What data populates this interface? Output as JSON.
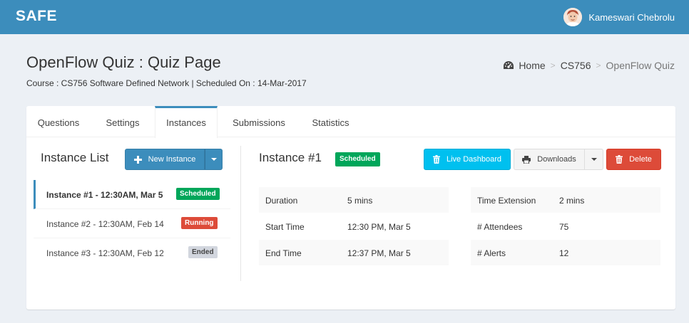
{
  "topbar": {
    "brand": "SAFE",
    "user_name": "Kameswari Chebrolu"
  },
  "page": {
    "title": "OpenFlow Quiz : Quiz Page",
    "subtitle": "Course : CS756 Software Defined Network | Scheduled On : 14-Mar-2017"
  },
  "breadcrumb": {
    "home": "Home",
    "course": "CS756",
    "current": "OpenFlow Quiz",
    "separator": ">"
  },
  "tabs": [
    {
      "label": "Questions"
    },
    {
      "label": "Settings"
    },
    {
      "label": "Instances"
    },
    {
      "label": "Submissions"
    },
    {
      "label": "Statistics"
    }
  ],
  "active_tab": "Instances",
  "instance_list": {
    "title": "Instance List",
    "new_button": "New Instance",
    "items": [
      {
        "label": "Instance #1 - 12:30AM, Mar 5",
        "status": "Scheduled",
        "color": "#00a65a"
      },
      {
        "label": "Instance #2 - 12:30AM, Feb 14",
        "status": "Running",
        "color": "#dd4b39"
      },
      {
        "label": "Instance #3 - 12:30AM, Feb 12",
        "status": "Ended",
        "color": "#d2d6de"
      }
    ]
  },
  "instance_detail": {
    "title": "Instance #1",
    "status": "Scheduled",
    "buttons": {
      "live_dashboard": "Live Dashboard",
      "downloads": "Downloads",
      "delete": "Delete"
    },
    "left_table": [
      {
        "key": "Duration",
        "value": "5 mins"
      },
      {
        "key": "Start Time",
        "value": "12:30 PM, Mar 5"
      },
      {
        "key": "End Time",
        "value": "12:37 PM, Mar 5"
      }
    ],
    "right_table": [
      {
        "key": "Time Extension",
        "value": "2 mins"
      },
      {
        "key": "# Attendees",
        "value": "75"
      },
      {
        "key": "# Alerts",
        "value": "12"
      }
    ]
  },
  "colors": {
    "primary": "#3c8dbc",
    "success": "#00a65a",
    "danger": "#dd4b39",
    "info": "#00c0ef",
    "background": "#ecf0f5"
  }
}
